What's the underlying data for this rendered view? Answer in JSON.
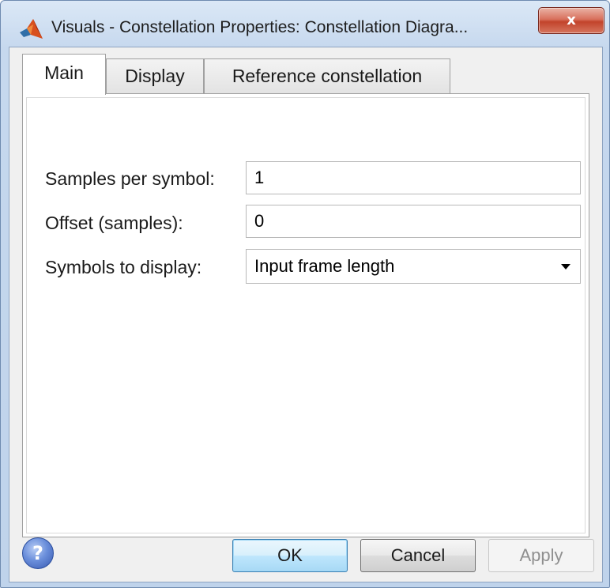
{
  "window": {
    "title": "Visuals - Constellation Properties: Constellation Diagra...",
    "app_icon": "matlab-logo-icon",
    "close_label": "x",
    "close_icon": "close-icon"
  },
  "tabs": [
    {
      "label": "Main",
      "active": true
    },
    {
      "label": "Display",
      "active": false
    },
    {
      "label": "Reference constellation",
      "active": false
    }
  ],
  "main": {
    "fields": {
      "samples_per_symbol": {
        "label": "Samples per symbol:",
        "value": "1"
      },
      "offset": {
        "label": "Offset (samples):",
        "value": "0"
      },
      "symbols_to_display": {
        "label": "Symbols to display:",
        "value": "Input frame length"
      }
    }
  },
  "footer": {
    "help_icon": "help-icon",
    "help_glyph": "?",
    "ok_label": "OK",
    "cancel_label": "Cancel",
    "apply_label": "Apply",
    "apply_enabled": false
  },
  "colors": {
    "titlebar": "#c6d8ee",
    "close_button": "#c2432b",
    "client_background": "#f0f0f0",
    "default_button": "#bee6fd",
    "disabled_text": "#8f8f8f"
  }
}
